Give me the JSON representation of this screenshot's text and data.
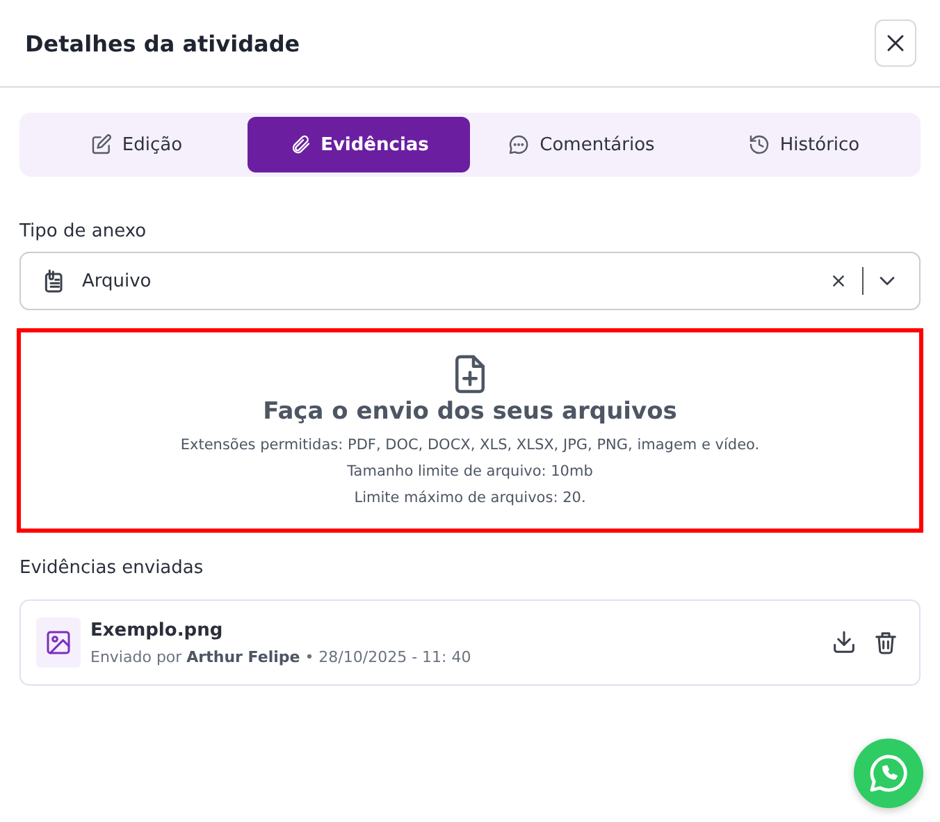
{
  "dialog": {
    "title": "Detalhes da atividade"
  },
  "tabs": [
    {
      "label": "Edição",
      "kind": "edit",
      "selected": false
    },
    {
      "label": "Evidências",
      "kind": "attach",
      "selected": true
    },
    {
      "label": "Comentários",
      "kind": "comment",
      "selected": false
    },
    {
      "label": "Histórico",
      "kind": "history",
      "selected": false
    }
  ],
  "attachment_type": {
    "label": "Tipo de anexo",
    "value": "Arquivo"
  },
  "upload": {
    "title": "Faça o envio dos seus arquivos",
    "lines": [
      "Extensões permitidas: PDF, DOC, DOCX, XLS, XLSX, JPG, PNG, imagem e vídeo.",
      "Tamanho limite de arquivo: 10mb",
      "Limite máximo de arquivos: 20."
    ]
  },
  "sent": {
    "label": "Evidências enviadas",
    "files": [
      {
        "name": "Exemplo.png",
        "meta": "Enviado por **Arthur Felipe** • 28/10/2025 - 11: 40"
      }
    ]
  }
}
